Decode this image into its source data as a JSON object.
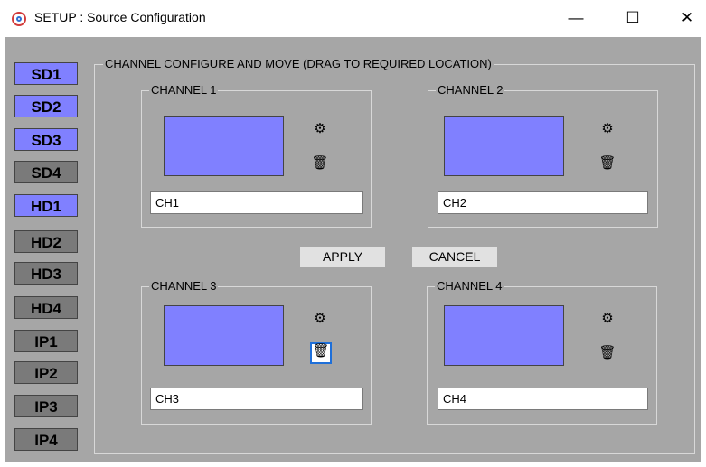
{
  "window": {
    "title": "SETUP : Source Configuration",
    "controls": {
      "minimize": "—",
      "maximize": "☐",
      "close": "✕"
    }
  },
  "sources": [
    {
      "label": "SD1",
      "state": "active"
    },
    {
      "label": "SD2",
      "state": "active"
    },
    {
      "label": "SD3",
      "state": "active"
    },
    {
      "label": "SD4",
      "state": "inactive"
    },
    {
      "label": "HD1",
      "state": "active"
    },
    {
      "label": "HD2",
      "state": "inactive"
    },
    {
      "label": "HD3",
      "state": "inactive"
    },
    {
      "label": "HD4",
      "state": "inactive"
    },
    {
      "label": "IP1",
      "state": "inactive"
    },
    {
      "label": "IP2",
      "state": "inactive"
    },
    {
      "label": "IP3",
      "state": "inactive"
    },
    {
      "label": "IP4",
      "state": "inactive"
    }
  ],
  "main_group": {
    "title": "CHANNEL CONFIGURE AND MOVE (DRAG TO REQUIRED LOCATION)"
  },
  "channels": [
    {
      "title": "CHANNEL 1",
      "name": "CH1",
      "settings_icon": "⚙",
      "delete_icon": "🗑"
    },
    {
      "title": "CHANNEL 2",
      "name": "CH2",
      "settings_icon": "⚙",
      "delete_icon": "🗑"
    },
    {
      "title": "CHANNEL 3",
      "name": "CH3",
      "settings_icon": "⚙",
      "delete_icon": "🗑"
    },
    {
      "title": "CHANNEL 4",
      "name": "CH4",
      "settings_icon": "⚙",
      "delete_icon": "🗑"
    }
  ],
  "actions": {
    "apply": "APPLY",
    "cancel": "CANCEL"
  },
  "colors": {
    "client_bg": "#a6a6a6",
    "source_active": "#8080ff",
    "source_inactive": "#7a7a7a",
    "preview": "#8080ff",
    "focus_border": "#1e6fd9"
  }
}
